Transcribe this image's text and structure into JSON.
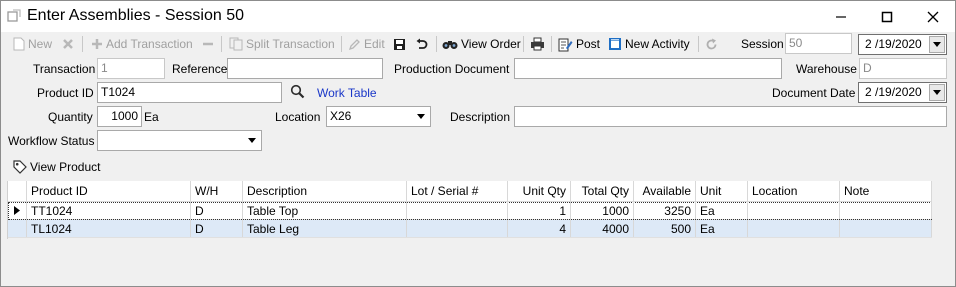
{
  "window": {
    "title": "Enter Assemblies - Session 50"
  },
  "toolbar": {
    "new": "New",
    "add_transaction": "Add Transaction",
    "split_transaction": "Split Transaction",
    "edit": "Edit",
    "view_order": "View Order",
    "post": "Post",
    "new_activity": "New Activity",
    "session_label": "Session",
    "session_value": "50",
    "date_value": "2 /19/2020"
  },
  "form": {
    "transaction_label": "Transaction",
    "transaction_value": "1",
    "reference_label": "Reference",
    "reference_value": "",
    "production_document_label": "Production Document",
    "production_document_value": "",
    "warehouse_label": "Warehouse",
    "warehouse_value": "D",
    "product_id_label": "Product ID",
    "product_id_value": "T1024",
    "work_table_link": "Work Table",
    "document_date_label": "Document Date",
    "document_date_value": "2 /19/2020",
    "quantity_label": "Quantity",
    "quantity_value": "1000",
    "quantity_unit": "Ea",
    "location_label": "Location",
    "location_value": "X26",
    "description_label": "Description",
    "description_value": "",
    "workflow_status_label": "Workflow Status",
    "workflow_status_value": ""
  },
  "view_product": "View Product",
  "grid": {
    "columns": [
      "Product ID",
      "W/H",
      "Description",
      "Lot / Serial #",
      "Unit Qty",
      "Total Qty",
      "Available",
      "Unit",
      "Location",
      "Note"
    ],
    "rows": [
      [
        "TT1024",
        "D",
        "Table Top",
        "",
        "1",
        "1000",
        "3250",
        "Ea",
        "",
        ""
      ],
      [
        "TL1024",
        "D",
        "Table Leg",
        "",
        "4",
        "4000",
        "500",
        "Ea",
        "",
        ""
      ]
    ]
  },
  "colors": {
    "link": "#1a37c8",
    "selected_row": "#dde9f7"
  },
  "icons": [
    "app-icon",
    "minimize-icon",
    "maximize-icon",
    "close-icon",
    "new-icon",
    "delete-icon",
    "add-icon",
    "remove-icon",
    "split-icon",
    "edit-icon",
    "save-icon",
    "undo-icon",
    "binoculars-icon",
    "print-icon",
    "post-icon",
    "new-activity-icon",
    "refresh-icon",
    "search-icon",
    "tag-icon",
    "row-pointer-icon",
    "dropdown-arrow-icon"
  ]
}
